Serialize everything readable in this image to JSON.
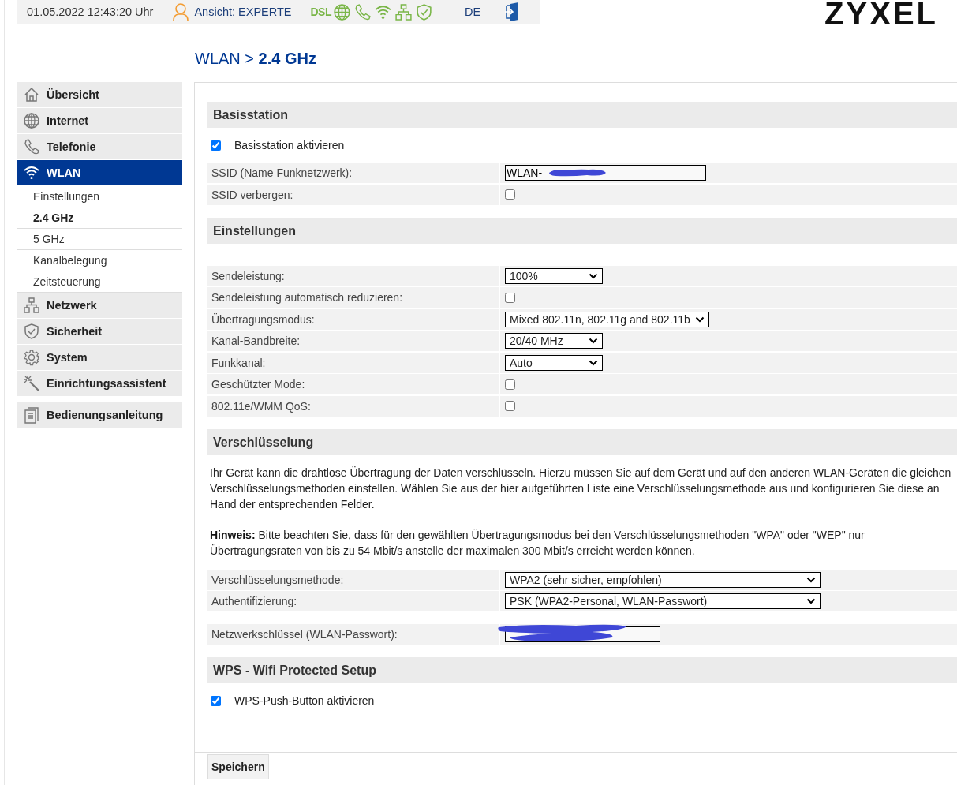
{
  "top_bar": {
    "datetime": "01.05.2022 12:43:20 Uhr",
    "view": "Ansicht: EXPERTE",
    "dsl_label": "DSL",
    "status_icons": [
      {
        "kind": "globe"
      },
      {
        "kind": "phone"
      },
      {
        "kind": "wifi"
      },
      {
        "kind": "network"
      },
      {
        "kind": "shield"
      }
    ],
    "language": "DE"
  },
  "logo": "ZYXEL",
  "breadcrumb": {
    "parent": "WLAN",
    "separator": ">",
    "current": "2.4 GHz"
  },
  "sidebar": {
    "items": [
      {
        "kind": "house",
        "label": "Übersicht",
        "selected": false
      },
      {
        "kind": "globe",
        "label": "Internet",
        "selected": false
      },
      {
        "kind": "phone",
        "label": "Telefonie",
        "selected": false
      },
      {
        "kind": "wifi",
        "label": "WLAN",
        "selected": true,
        "children": [
          {
            "label": "Einstellungen",
            "selected": false
          },
          {
            "label": "2.4 GHz",
            "selected": true
          },
          {
            "label": "5 GHz",
            "selected": false
          },
          {
            "label": "Kanalbelegung",
            "selected": false
          },
          {
            "label": "Zeitsteuerung",
            "selected": false
          }
        ]
      },
      {
        "kind": "network",
        "label": "Netzwerk",
        "selected": false
      },
      {
        "kind": "shield",
        "label": "Sicherheit",
        "selected": false
      },
      {
        "kind": "gear",
        "label": "System",
        "selected": false
      },
      {
        "kind": "wand",
        "label": "Einrichtungsassistent",
        "selected": false
      }
    ],
    "footer_items": [
      {
        "kind": "document",
        "label": "Bedienungsanleitung",
        "selected": false
      }
    ]
  },
  "sections": [
    {
      "kind": "base",
      "title": "Basisstation",
      "rows": [
        {
          "kind": "checkline",
          "label": "Basisstation aktivieren",
          "checked": true
        },
        {
          "kind": "text",
          "label": "SSID (Name Funknetzwerk):",
          "value": "WLAN-",
          "redacted": true
        },
        {
          "kind": "checkbox",
          "label": "SSID verbergen:",
          "checked": false
        }
      ]
    },
    {
      "kind": "settings",
      "title": "Einstellungen",
      "rows": [
        {
          "kind": "select",
          "label": "Sendeleistung:",
          "value": "100%"
        },
        {
          "kind": "checkbox",
          "label": "Sendeleistung automatisch reduzieren:",
          "checked": false
        },
        {
          "kind": "select",
          "label": "Übertragungsmodus:",
          "value": "Mixed 802.11n, 802.11g and 802.11b"
        },
        {
          "kind": "select",
          "label": "Kanal-Bandbreite:",
          "value": "20/40 MHz"
        },
        {
          "kind": "select",
          "label": "Funkkanal:",
          "value": "Auto"
        },
        {
          "kind": "checkbox",
          "label": "Geschützter Mode:",
          "checked": false
        },
        {
          "kind": "checkbox",
          "label": "802.11e/WMM QoS:",
          "checked": false
        }
      ]
    },
    {
      "kind": "encryption",
      "title": "Verschlüsselung",
      "paragraphs": [
        "Ihr Gerät kann die drahtlose Übertragung der Daten verschlüsseln. Hierzu müssen Sie auf dem Gerät und auf den anderen WLAN-Geräten die gleichen Verschlüsselungsmethoden einstellen. Wählen Sie aus der hier aufgeführten Liste eine Verschlüsselungsmethode aus und konfigurieren Sie diese an Hand der entsprechenden Felder.",
        "**Hinweis:** Bitte beachten Sie, dass für den gewählten Übertragungsmodus bei den Verschlüsselungsmethoden \"WPA\" oder \"WEP\" nur Übertragungsraten von bis zu 54 Mbit/s anstelle der maximalen 300 Mbit/s erreicht werden können."
      ],
      "rows": [
        {
          "kind": "select",
          "label": "Verschlüsselungsmethode:",
          "value": "WPA2 (sehr sicher, empfohlen)"
        },
        {
          "kind": "select",
          "label": "Authentifizierung:",
          "value": "PSK (WPA2-Personal, WLAN-Passwort)"
        },
        {
          "kind": "text",
          "label": "Netzwerkschlüssel (WLAN-Passwort):",
          "value": "",
          "redacted": true
        }
      ]
    },
    {
      "kind": "wps",
      "title": "WPS - Wifi Protected Setup",
      "rows": [
        {
          "kind": "checkline",
          "label": "WPS-Push-Button aktivieren",
          "checked": true
        }
      ]
    }
  ],
  "save_button": "Speichern"
}
